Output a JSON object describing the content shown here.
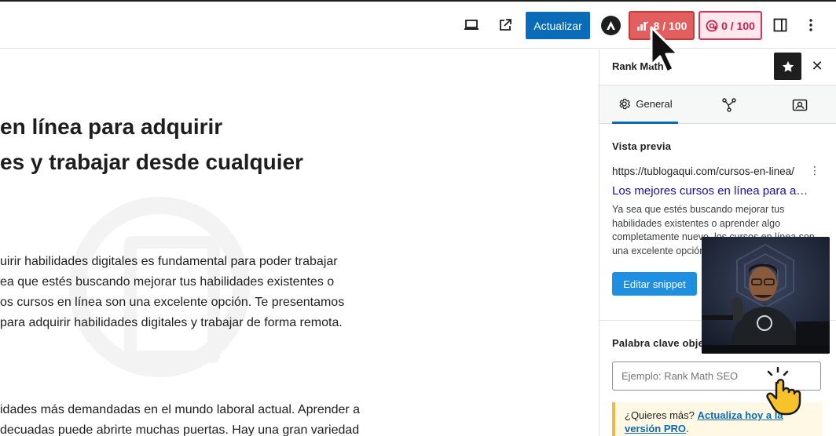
{
  "toolbar": {
    "update_label": "Actualizar",
    "seo_score": "8 / 100",
    "readability_score": "0 / 100",
    "icons": [
      "laptop-icon",
      "external-link-icon",
      "astra-icon",
      "seo-score-icon",
      "readability-icon",
      "sidebar-toggle-icon",
      "kebab-menu-icon"
    ]
  },
  "editor": {
    "title_lines": [
      "en línea para adquirir",
      "es y trabajar desde cualquier"
    ],
    "paragraph1": [
      "uirir habilidades digitales es fundamental para poder trabajar",
      "ea que estés buscando mejorar tus habilidades existentes o",
      "os cursos en línea son una excelente opción. Te presentamos",
      "para adquirir habilidades digitales y trabajar de forma remota."
    ],
    "paragraph2": [
      "idades más demandadas en el mundo laboral actual. Aprender a",
      "decuadas puede abrirte muchas puertas. Hay una gran variedad"
    ]
  },
  "sidebar": {
    "title": "Rank Math",
    "tabs": [
      {
        "label": "General"
      },
      {
        "label": ""
      },
      {
        "label": ""
      }
    ],
    "preview": {
      "heading": "Vista previa",
      "url": "https://tublogaqui.com/cursos-en-linea/",
      "seo_title": "Los mejores cursos en línea para a…",
      "description": "Ya sea que estés buscando mejorar tus habilidades existentes o aprender algo completamente nuevo, los cursos en línea son una excelente opción.",
      "edit_button": "Editar snippet"
    },
    "keyword": {
      "heading": "Palabra clave objetivo",
      "placeholder": "Ejemplo: Rank Math SEO"
    },
    "notice": {
      "text": "¿Quieres más? ",
      "link_1": "Actualiza hoy a la",
      "link_2": "versión PRO",
      "end": "."
    }
  },
  "colors": {
    "accent": "#0a6cb8",
    "seo_bad": "#e35f5f",
    "readability": "#d6335c"
  }
}
